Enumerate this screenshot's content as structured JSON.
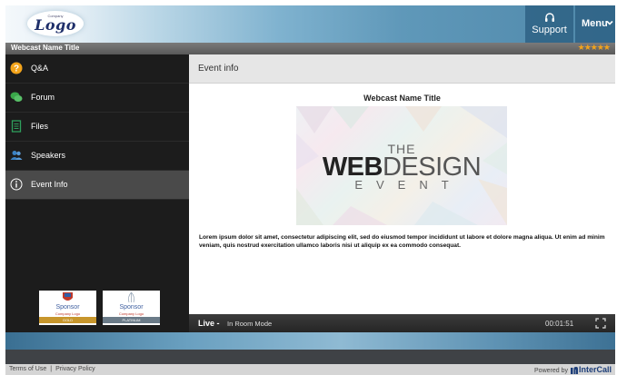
{
  "header": {
    "logo_text": "Logo",
    "logo_small": "Company",
    "support_label": "Support",
    "menu_label": "Menu"
  },
  "title_strip": {
    "webcast_title": "Webcast Name Title",
    "rating_stars": "★★★★★",
    "rating": 5
  },
  "sidebar": {
    "items": [
      {
        "label": "Q&A",
        "icon": "qa-icon"
      },
      {
        "label": "Forum",
        "icon": "forum-icon"
      },
      {
        "label": "Files",
        "icon": "files-icon"
      },
      {
        "label": "Speakers",
        "icon": "speakers-icon"
      },
      {
        "label": "Event Info",
        "icon": "info-icon",
        "active": true
      }
    ],
    "sponsors": [
      {
        "name": "Sponsor",
        "company": "Company Logo",
        "tier": "GOLD"
      },
      {
        "name": "Sponsor",
        "company": "Company Logo",
        "tier": "PLATINUM"
      }
    ]
  },
  "main": {
    "header_title": "Event info",
    "event_title": "Webcast Name Title",
    "banner": {
      "the": "THE",
      "web": "WEB",
      "design": "DESIGN",
      "event": "EVENT"
    },
    "description": "Lorem ipsum dolor sit amet, consectetur adipiscing elit, sed do eiusmod tempor incididunt ut labore et dolore magna aliqua. Ut enim ad minim veniam, quis nostrud exercitation ullamco laboris nisi ut aliquip ex ea commodo consequat."
  },
  "live_bar": {
    "live_label": "Live -",
    "mode": "In Room Mode",
    "timer": "00:01:51"
  },
  "footer": {
    "terms": "Terms of Use",
    "separator": "|",
    "privacy": "Privacy Policy",
    "powered_by": "Powered by",
    "brand": "InterCall"
  },
  "colors": {
    "accent_orange": "#f3a41b",
    "forum_green": "#3aa84a",
    "files_green": "#2f9f5c",
    "speakers_blue": "#3b82c4",
    "sidebar_bg": "#1c1c1c",
    "active_bg": "#4a4a4a"
  }
}
